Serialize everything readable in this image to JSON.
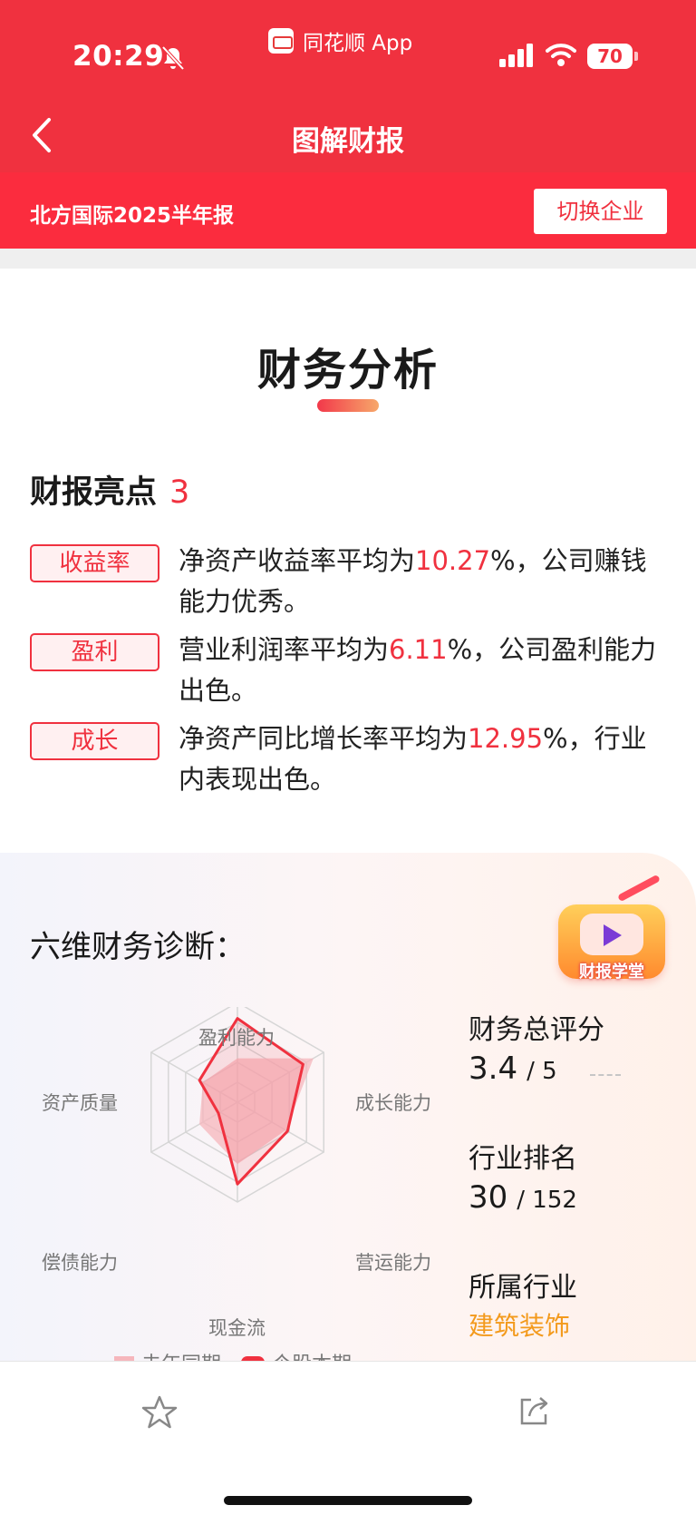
{
  "status_bar": {
    "time": "20:29",
    "app_name": "同花顺 App",
    "battery": "70",
    "icons": [
      "bell-slash-icon",
      "signal-icon",
      "wifi-icon",
      "battery-icon"
    ]
  },
  "nav": {
    "title": "图解财报",
    "back_icon": "chevron-left-icon"
  },
  "subheader": {
    "company_report": "北方国际2025半年报",
    "switch_button": "切换企业"
  },
  "section": {
    "title": "财务分析"
  },
  "highlights": {
    "title": "财报亮点",
    "count": "3",
    "items": [
      {
        "tag": "收益率",
        "pre": "净资产收益率平均为",
        "value": "10.27",
        "post": "%，公司赚钱能力优秀。"
      },
      {
        "tag": "盈利",
        "pre": "营业利润率平均为",
        "value": "6.11",
        "post": "%，公司盈利能力出色。"
      },
      {
        "tag": "成长",
        "pre": "净资产同比增长率平均为",
        "value": "12.95",
        "post": "%，行业内表现出色。"
      }
    ]
  },
  "diagnosis": {
    "title": "六维财务诊断：",
    "mascot_label": "财报学堂",
    "dimensions": [
      "盈利能力",
      "成长能力",
      "营运能力",
      "现金流",
      "偿债能力",
      "资产质量"
    ],
    "legend": [
      "去年同期",
      "个股本期"
    ],
    "total_score_label": "财务总评分",
    "total_score": "3.4",
    "total_score_max": "/ 5",
    "rank_label": "行业排名",
    "rank": "30",
    "rank_total": "/ 152",
    "industry_label": "所属行业",
    "industry": "建筑装饰"
  },
  "chart_data": {
    "type": "radar",
    "categories": [
      "盈利能力",
      "成长能力",
      "营运能力",
      "现金流",
      "偿债能力",
      "资产质量"
    ],
    "max": 5,
    "series": [
      {
        "name": "去年同期",
        "values": [
          2.2,
          4.4,
          2.8,
          3.1,
          2.2,
          2.0
        ],
        "color": "#f6b6bc"
      },
      {
        "name": "个股本期",
        "values": [
          4.2,
          3.8,
          2.9,
          4.1,
          1.1,
          2.2
        ],
        "color": "#f0313f"
      }
    ]
  },
  "bottom_bar": {
    "icons": [
      "star-icon",
      "share-icon"
    ]
  },
  "colors": {
    "brand_red": "#f0313f",
    "subbar_red": "#fb2c3e",
    "industry_orange": "#f39a1c"
  }
}
